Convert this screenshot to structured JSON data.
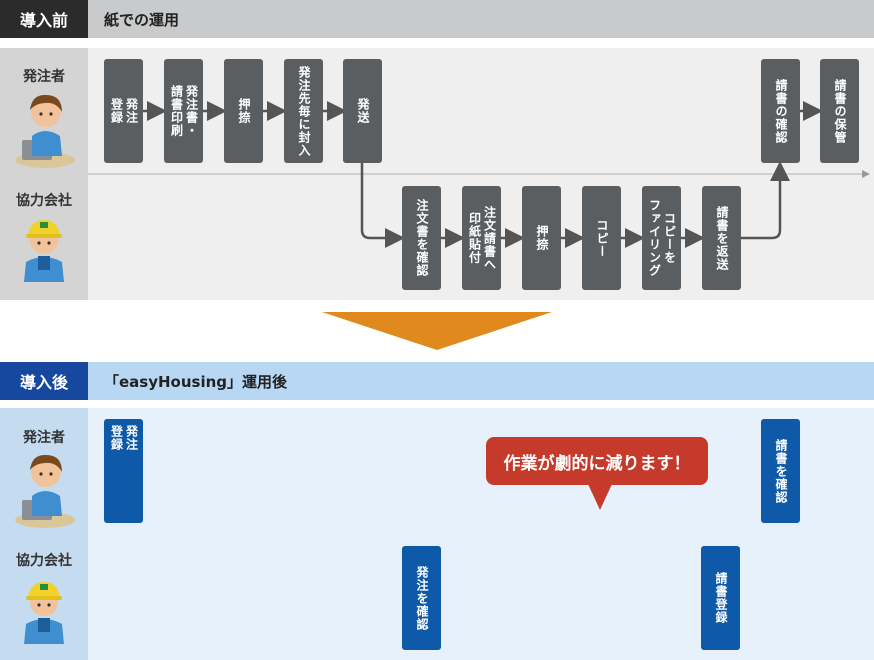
{
  "before": {
    "tag": "導入前",
    "title": "紙での運用",
    "lane_orderer": "発注者",
    "lane_partner": "協力会社",
    "orderer_steps": [
      {
        "cols": [
          "発注",
          "登録"
        ]
      },
      {
        "cols": [
          "発注書・",
          "請書印刷"
        ]
      },
      {
        "cols": [
          "押捺"
        ]
      },
      {
        "cols": [
          "発注先毎に封入"
        ]
      },
      {
        "cols": [
          "発送"
        ]
      },
      {
        "cols": [
          "請書の確認"
        ]
      },
      {
        "cols": [
          "請書の保管"
        ]
      }
    ],
    "partner_steps": [
      {
        "cols": [
          "注文書を確認"
        ]
      },
      {
        "cols": [
          "注文請書へ",
          "印紙貼付"
        ]
      },
      {
        "cols": [
          "押捺"
        ]
      },
      {
        "cols": [
          "コピー"
        ]
      },
      {
        "cols": [
          "コピーを",
          "ファイリング"
        ]
      },
      {
        "cols": [
          "請書を返送"
        ]
      }
    ]
  },
  "after": {
    "tag": "導入後",
    "title": "「easyHousing」運用後",
    "lane_orderer": "発注者",
    "lane_partner": "協力会社",
    "orderer_steps": [
      {
        "cols": [
          "発注",
          "登録"
        ]
      },
      {
        "cols": [
          "請書を確認"
        ]
      }
    ],
    "partner_steps": [
      {
        "cols": [
          "発注を確認"
        ]
      },
      {
        "cols": [
          "請書登録"
        ]
      }
    ],
    "callout": "作業が劇的に減ります！"
  },
  "colors": {
    "dark_header": "#2b2b2b",
    "gray_bar": "#c9cacb",
    "gray_bg": "#efefef",
    "gray_label_bg": "#d4d4d4",
    "step_gray": "#5b5e60",
    "orange_arrow": "#e08a1e",
    "blue_header": "#15489e",
    "blue_bar": "#b7d7f2",
    "blue_bg": "#e6f1fb",
    "blue_label_bg": "#c5dcf0",
    "step_blue": "#0e5aa8",
    "callout_red": "#c53a2a"
  },
  "icons": [
    "office-worker-avatar-icon",
    "construction-worker-avatar-icon"
  ]
}
